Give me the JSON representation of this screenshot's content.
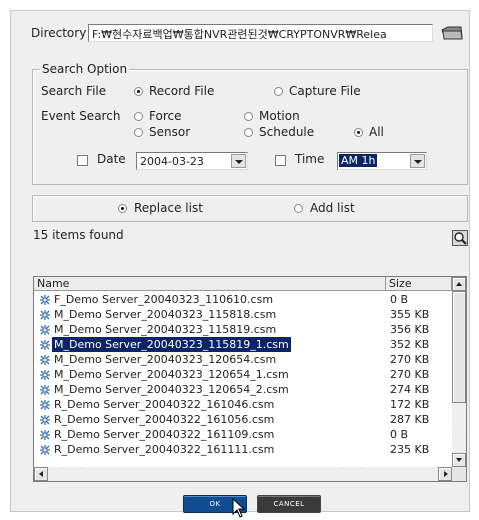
{
  "directory": {
    "label": "Directory :",
    "path": "F:₩현수자료백업₩통합NVR관련된것₩CRYPTONVR₩Relea",
    "browse_icon": "folder-open-icon"
  },
  "search_option": {
    "legend": "Search Option",
    "search_file_label": "Search File",
    "record_file_label": "Record File",
    "capture_file_label": "Capture File",
    "selected_file_type": "Record File",
    "event_search_label": "Event Search",
    "events": {
      "force": "Force",
      "motion": "Motion",
      "sensor": "Sensor",
      "schedule": "Schedule",
      "all": "All"
    },
    "selected_event": "All",
    "date_label": "Date",
    "date_checked": false,
    "date_value": "2004-03-23",
    "time_label": "Time",
    "time_checked": false,
    "time_value": "AM 1h"
  },
  "list_mode": {
    "replace_label": "Replace list",
    "add_label": "Add list",
    "selected": "Replace list"
  },
  "results": {
    "count_text": "15 items found",
    "search_icon": "magnifier-icon",
    "columns": {
      "name": "Name",
      "size": "Size"
    },
    "rows": [
      {
        "name": "F_Demo Server_20040323_110610.csm",
        "size": "0 B",
        "selected": false
      },
      {
        "name": "M_Demo Server_20040323_115818.csm",
        "size": "355 KB",
        "selected": false
      },
      {
        "name": "M_Demo Server_20040323_115819.csm",
        "size": "356 KB",
        "selected": false
      },
      {
        "name": "M_Demo Server_20040323_115819_1.csm",
        "size": "352 KB",
        "selected": true
      },
      {
        "name": "M_Demo Server_20040323_120654.csm",
        "size": "270 KB",
        "selected": false
      },
      {
        "name": "M_Demo Server_20040323_120654_1.csm",
        "size": "270 KB",
        "selected": false
      },
      {
        "name": "M_Demo Server_20040323_120654_2.csm",
        "size": "274 KB",
        "selected": false
      },
      {
        "name": "R_Demo Server_20040322_161046.csm",
        "size": "172 KB",
        "selected": false
      },
      {
        "name": "R_Demo Server_20040322_161056.csm",
        "size": "287 KB",
        "selected": false
      },
      {
        "name": "R_Demo Server_20040322_161109.csm",
        "size": "0 B",
        "selected": false
      },
      {
        "name": "R_Demo Server_20040322_161111.csm",
        "size": "235 KB",
        "selected": false
      }
    ]
  },
  "buttons": {
    "ok": "OK",
    "cancel": "CANCEL"
  },
  "colors": {
    "selection": "#0a246a",
    "ok_button": "#0f4c92",
    "cancel_button": "#3a3a3a"
  }
}
